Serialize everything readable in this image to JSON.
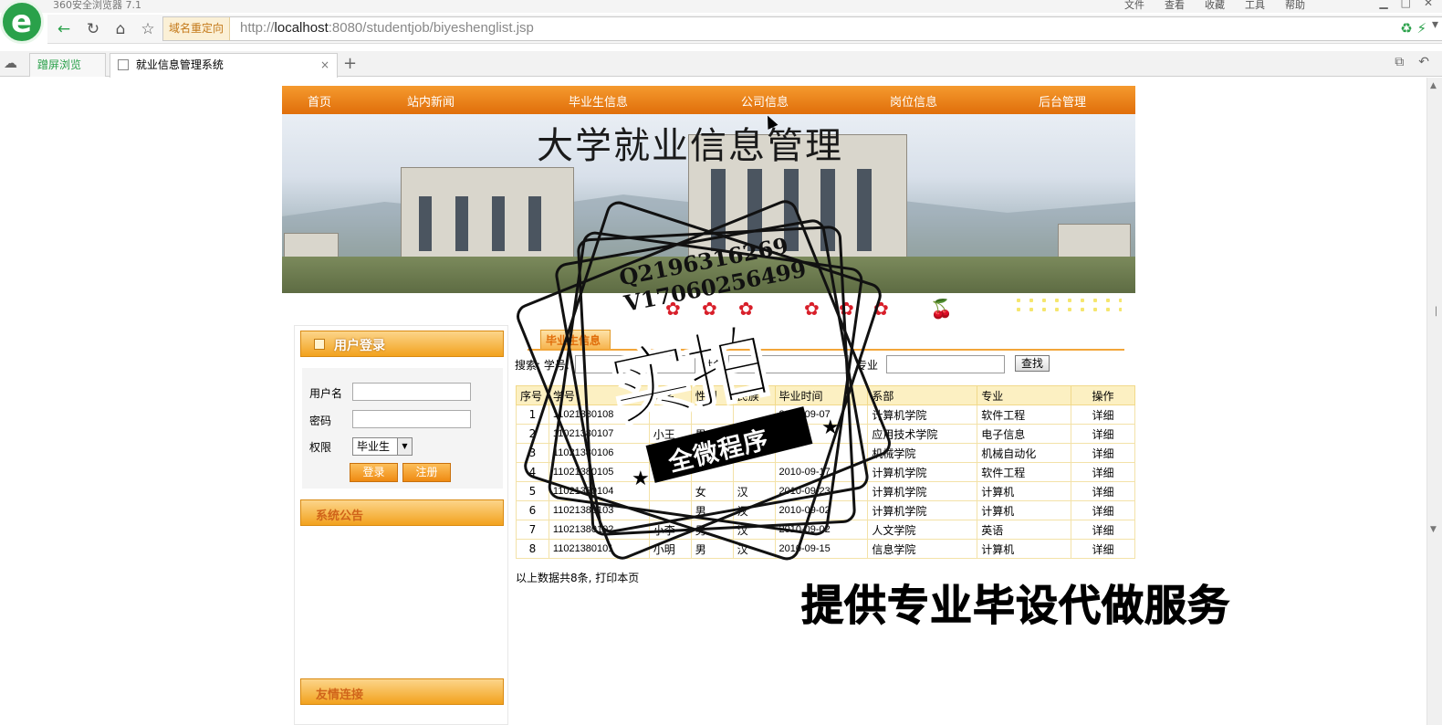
{
  "browser": {
    "app_title": "360安全浏览器 7.1",
    "menus": [
      "文件",
      "查看",
      "收藏",
      "工具",
      "帮助"
    ],
    "redirect_tag": "域名重定向",
    "url_prefix": "http://",
    "url_host": "localhost",
    "url_rest": ":8080/studentjob/biyeshenglist.jsp",
    "split_tab_label": "蹭屏浏览",
    "active_tab_label": "就业信息管理系统",
    "close_glyph": "×",
    "new_tab_glyph": "+"
  },
  "nav": {
    "items": [
      "首页",
      "站内新闻",
      "毕业生信息",
      "公司信息",
      "岗位信息",
      "后台管理"
    ]
  },
  "banner": {
    "title": "大学就业信息管理"
  },
  "sidebar": {
    "login_title": "用户登录",
    "username_label": "用户名",
    "password_label": "密码",
    "role_label": "权限",
    "role_selected": "毕业生",
    "login_button": "登录",
    "register_button": "注册",
    "notice_title": "系统公告",
    "links_title": "友情连接"
  },
  "content": {
    "tab_label": "毕业生信息",
    "search_label": "搜索: 学号:",
    "name_label": "姓名",
    "major_label": "专业",
    "find_button": "查找",
    "columns": [
      "序号",
      "学号",
      "姓名",
      "性别",
      "民族",
      "毕业时间",
      "系部",
      "专业",
      "操作"
    ],
    "rows": [
      [
        "1",
        "11021380108",
        "",
        "",
        "",
        "2010-09-07",
        "计算机学院",
        "软件工程",
        "详细"
      ],
      [
        "2",
        "11021380107",
        "小王",
        "男",
        "汉",
        "",
        "应用技术学院",
        "电子信息",
        "详细"
      ],
      [
        "3",
        "11021380106",
        "",
        "",
        "",
        "",
        "机械学院",
        "机械自动化",
        "详细"
      ],
      [
        "4",
        "11021380105",
        "",
        "",
        "",
        "2010-09-17",
        "计算机学院",
        "软件工程",
        "详细"
      ],
      [
        "5",
        "11021380104",
        "",
        "女",
        "汉",
        "2010-09-23",
        "计算机学院",
        "计算机",
        "详细"
      ],
      [
        "6",
        "11021380103",
        "",
        "男",
        "汉",
        "2010-09-02",
        "计算机学院",
        "计算机",
        "详细"
      ],
      [
        "7",
        "11021380102",
        "小李",
        "男",
        "汉",
        "2010-09-02",
        "人文学院",
        "英语",
        "详细"
      ],
      [
        "8",
        "11021380101",
        "小明",
        "男",
        "汉",
        "2010-09-15",
        "信息学院",
        "计算机",
        "详细"
      ]
    ],
    "summary_text": "以上数据共8条, 打印本页"
  },
  "watermark": {
    "contact_line1": "Q2196316269",
    "contact_line2": "V17060256499",
    "stamp_text": "实拍",
    "band_text": "全微程序",
    "service_text": "提供专业毕设代做服务"
  },
  "colors": {
    "nav_orange": "#e06e0a",
    "header_gold": "#f2a21e",
    "table_header": "#fcf0c2",
    "browser_green": "#2aa14a"
  }
}
